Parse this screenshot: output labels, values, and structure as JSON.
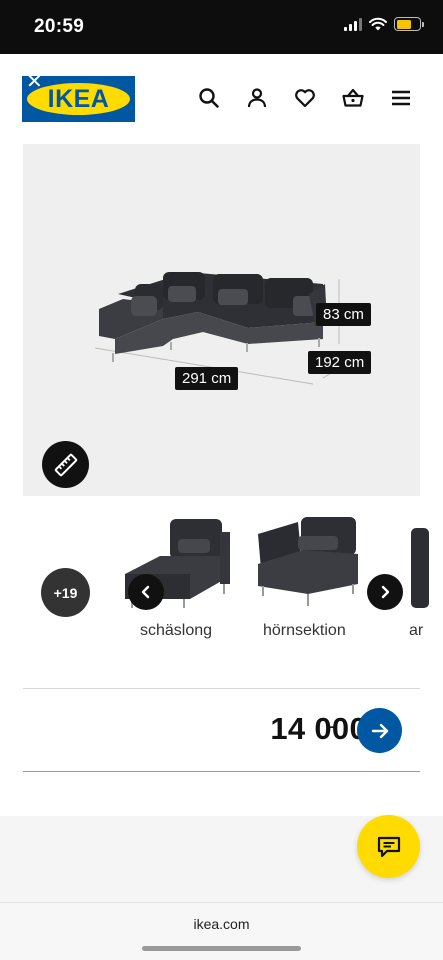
{
  "status_bar": {
    "time": "20:59"
  },
  "header": {
    "logo_text": "IKEA",
    "icons": [
      "search-icon",
      "account-icon",
      "heart-icon",
      "basket-icon",
      "menu-icon"
    ]
  },
  "product_image": {
    "dimensions": {
      "width": "291 cm",
      "depth": "192 cm",
      "height": "83 cm"
    }
  },
  "variants": {
    "more_count": "+19",
    "items": [
      {
        "label": "schäslong"
      },
      {
        "label": "hörnsektion"
      },
      {
        "label": "ar"
      }
    ]
  },
  "price": {
    "amount": "14 000",
    "suffix": ":-"
  },
  "browser": {
    "url": "ikea.com"
  },
  "colors": {
    "brand_blue": "#0058a3",
    "brand_yellow": "#ffdb00",
    "status_bar": "#0d0d0d"
  }
}
